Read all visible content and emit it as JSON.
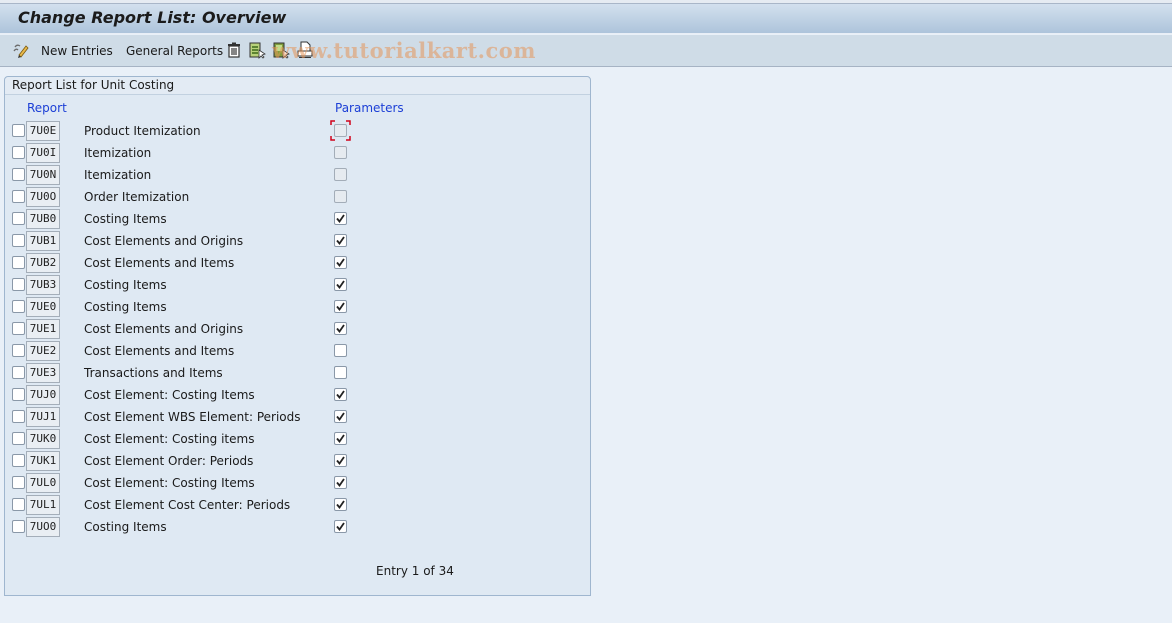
{
  "window": {
    "title": "Change Report List: Overview"
  },
  "toolbar": {
    "new_entries_label": "New Entries",
    "general_reports_label": "General Reports",
    "icons": [
      "edit-toggle-icon",
      "delete-icon",
      "select-all-icon",
      "deselect-all-icon",
      "print-icon"
    ]
  },
  "watermark": "www.tutorialkart.com",
  "panel": {
    "title": "Report List for Unit Costing",
    "columns": {
      "report": "Report",
      "parameters": "Parameters"
    },
    "rows": [
      {
        "code": "7U0E",
        "description": "Product Itemization",
        "parameters": false,
        "parameters_enabled": false,
        "focused": true
      },
      {
        "code": "7U0I",
        "description": "Itemization",
        "parameters": false,
        "parameters_enabled": false
      },
      {
        "code": "7U0N",
        "description": "Itemization",
        "parameters": false,
        "parameters_enabled": false
      },
      {
        "code": "7U0O",
        "description": "Order Itemization",
        "parameters": false,
        "parameters_enabled": false
      },
      {
        "code": "7UB0",
        "description": "Costing Items",
        "parameters": true,
        "parameters_enabled": true
      },
      {
        "code": "7UB1",
        "description": "Cost Elements and Origins",
        "parameters": true,
        "parameters_enabled": true
      },
      {
        "code": "7UB2",
        "description": "Cost Elements and Items",
        "parameters": true,
        "parameters_enabled": true
      },
      {
        "code": "7UB3",
        "description": "Costing Items",
        "parameters": true,
        "parameters_enabled": true
      },
      {
        "code": "7UE0",
        "description": "Costing Items",
        "parameters": true,
        "parameters_enabled": true
      },
      {
        "code": "7UE1",
        "description": "Cost Elements and Origins",
        "parameters": true,
        "parameters_enabled": true
      },
      {
        "code": "7UE2",
        "description": "Cost Elements and Items",
        "parameters": false,
        "parameters_enabled": true
      },
      {
        "code": "7UE3",
        "description": "Transactions and Items",
        "parameters": false,
        "parameters_enabled": true
      },
      {
        "code": "7UJ0",
        "description": "Cost Element: Costing Items",
        "parameters": true,
        "parameters_enabled": true
      },
      {
        "code": "7UJ1",
        "description": "Cost Element WBS Element: Periods",
        "parameters": true,
        "parameters_enabled": true
      },
      {
        "code": "7UK0",
        "description": "Cost Element: Costing items",
        "parameters": true,
        "parameters_enabled": true
      },
      {
        "code": "7UK1",
        "description": "Cost Element Order: Periods",
        "parameters": true,
        "parameters_enabled": true
      },
      {
        "code": "7UL0",
        "description": "Cost Element: Costing Items",
        "parameters": true,
        "parameters_enabled": true
      },
      {
        "code": "7UL1",
        "description": "Cost Element Cost Center: Periods",
        "parameters": true,
        "parameters_enabled": true
      },
      {
        "code": "7UO0",
        "description": "Costing Items",
        "parameters": true,
        "parameters_enabled": true
      }
    ],
    "entry_status": "Entry 1 of 34"
  },
  "colors": {
    "column_header": "#1c3fd6",
    "focus_marker": "#d0021b"
  }
}
